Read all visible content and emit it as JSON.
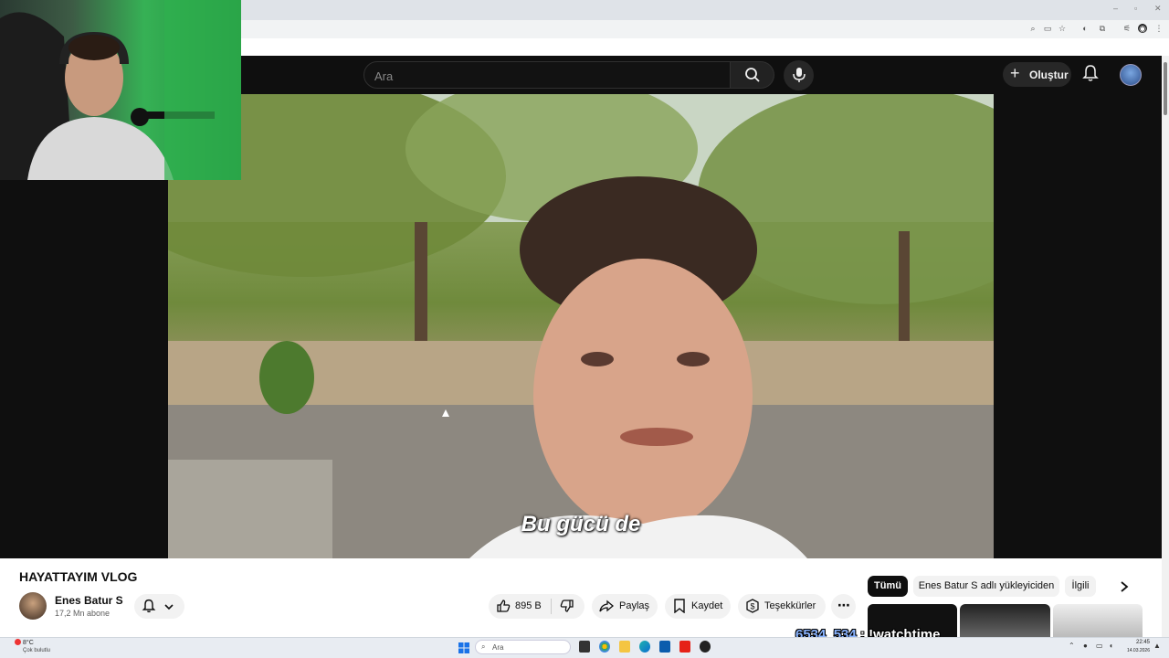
{
  "browser": {
    "window_controls": [
      "–",
      "▫",
      "✕"
    ]
  },
  "header": {
    "search_placeholder": "Ara",
    "create_label": "Oluştur"
  },
  "video": {
    "subtitle": "Bu gücü de",
    "title": "HAYATTAYIM VLOG"
  },
  "channel": {
    "name": "Enes Batur S",
    "subscribers": "17,2 Mn abone"
  },
  "actions": {
    "like_count": "895 B",
    "share": "Paylaş",
    "save": "Kaydet",
    "thanks": "Teşekkürler"
  },
  "chips": {
    "all": "Tümü",
    "uploader": "Enes Batur S adlı yükleyiciden",
    "related": "İlgili"
  },
  "stream_overlay": {
    "user": "6534_534",
    "message": " : !watchtime"
  },
  "taskbar": {
    "weather_temp": "8°C",
    "weather_desc": "Çok bulutlu",
    "search_placeholder": "Ara",
    "time": "22:45",
    "date": "14.03.2026"
  },
  "colors": {
    "header_bg": "#0f0f0f",
    "page_bg": "#ffffff",
    "chip_active": "#0f0f0f"
  }
}
